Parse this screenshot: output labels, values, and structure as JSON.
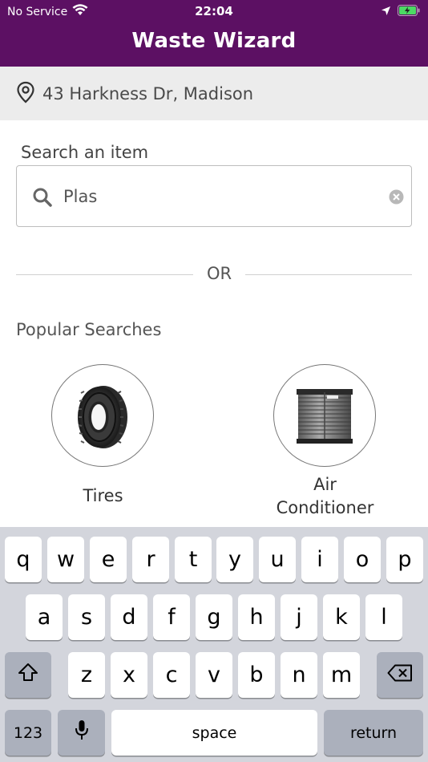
{
  "status_bar": {
    "carrier": "No Service",
    "time": "22:04"
  },
  "header": {
    "title": "Waste Wizard",
    "background_color": "#5c1063"
  },
  "address": {
    "icon": "location-pin-icon",
    "text": "43 Harkness Dr, Madison"
  },
  "search": {
    "label": "Search an item",
    "value": "Plas",
    "icon": "search-icon",
    "clear_icon": "clear-circle-icon"
  },
  "divider": {
    "text": "OR"
  },
  "popular": {
    "heading": "Popular Searches",
    "items": [
      {
        "label": "Tires",
        "icon": "tire-image"
      },
      {
        "label": "Air\nConditioner",
        "line1": "Air",
        "line2": "Conditioner",
        "icon": "air-conditioner-image"
      }
    ]
  },
  "keyboard": {
    "row1": [
      "q",
      "w",
      "e",
      "r",
      "t",
      "y",
      "u",
      "i",
      "o",
      "p"
    ],
    "row2": [
      "a",
      "s",
      "d",
      "f",
      "g",
      "h",
      "j",
      "k",
      "l"
    ],
    "row3": [
      "z",
      "x",
      "c",
      "v",
      "b",
      "n",
      "m"
    ],
    "numbers_label": "123",
    "space_label": "space",
    "return_label": "return",
    "shift_icon": "shift-icon",
    "delete_icon": "backspace-icon",
    "mic_icon": "microphone-icon"
  }
}
